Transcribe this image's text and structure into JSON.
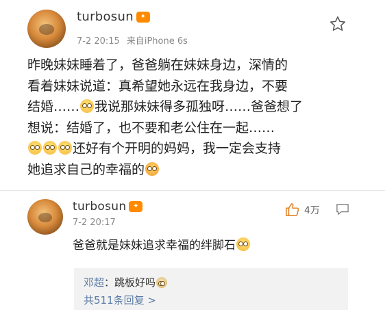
{
  "post": {
    "username": "turbosun",
    "vip_badge": "icon-vip",
    "date": "7-2 20:15",
    "source": "来自iPhone 6s",
    "body_lines": [
      "昨晚妹妹睡着了，爸爸躺在妹妹身边，深情的",
      "看着妹妹说道：真希望她永远在我身边，不要",
      "结婚……{emoji}我说那妹妹得多孤独呀……爸爸想了",
      "想说：结婚了，也不要和老公住在一起……",
      "{emoji}{emoji}{emoji}还好有个开明的妈妈，我一定会支持",
      "她追求自己的幸福的{emoji}"
    ],
    "line1": "昨晚妹妹睡着了，爸爸躺在妹妹身边，深情的",
    "line2": "看着妹妹说道：真希望她永远在我身边，不要",
    "line3a": "结婚……",
    "line3b": "我说那妹妹得多孤独呀……爸爸想了",
    "line4": "想说：结婚了，也不要和老公住在一起……",
    "line5b": "还好有个开明的妈妈，我一定会支持",
    "line6a": "她追求自己的幸福的"
  },
  "comment": {
    "username": "turbosun",
    "date": "7-2 20:17",
    "text": "爸爸就是妹妹追求幸福的绊脚石",
    "like_count": "4万",
    "replies": {
      "author": "邓超",
      "separator": "：",
      "text": "跳板好吗",
      "more": "共511条回复 >"
    }
  },
  "colors": {
    "link": "#5b7ba6",
    "vip": "#ff8a00",
    "reply_bg": "#f2f2f2"
  }
}
